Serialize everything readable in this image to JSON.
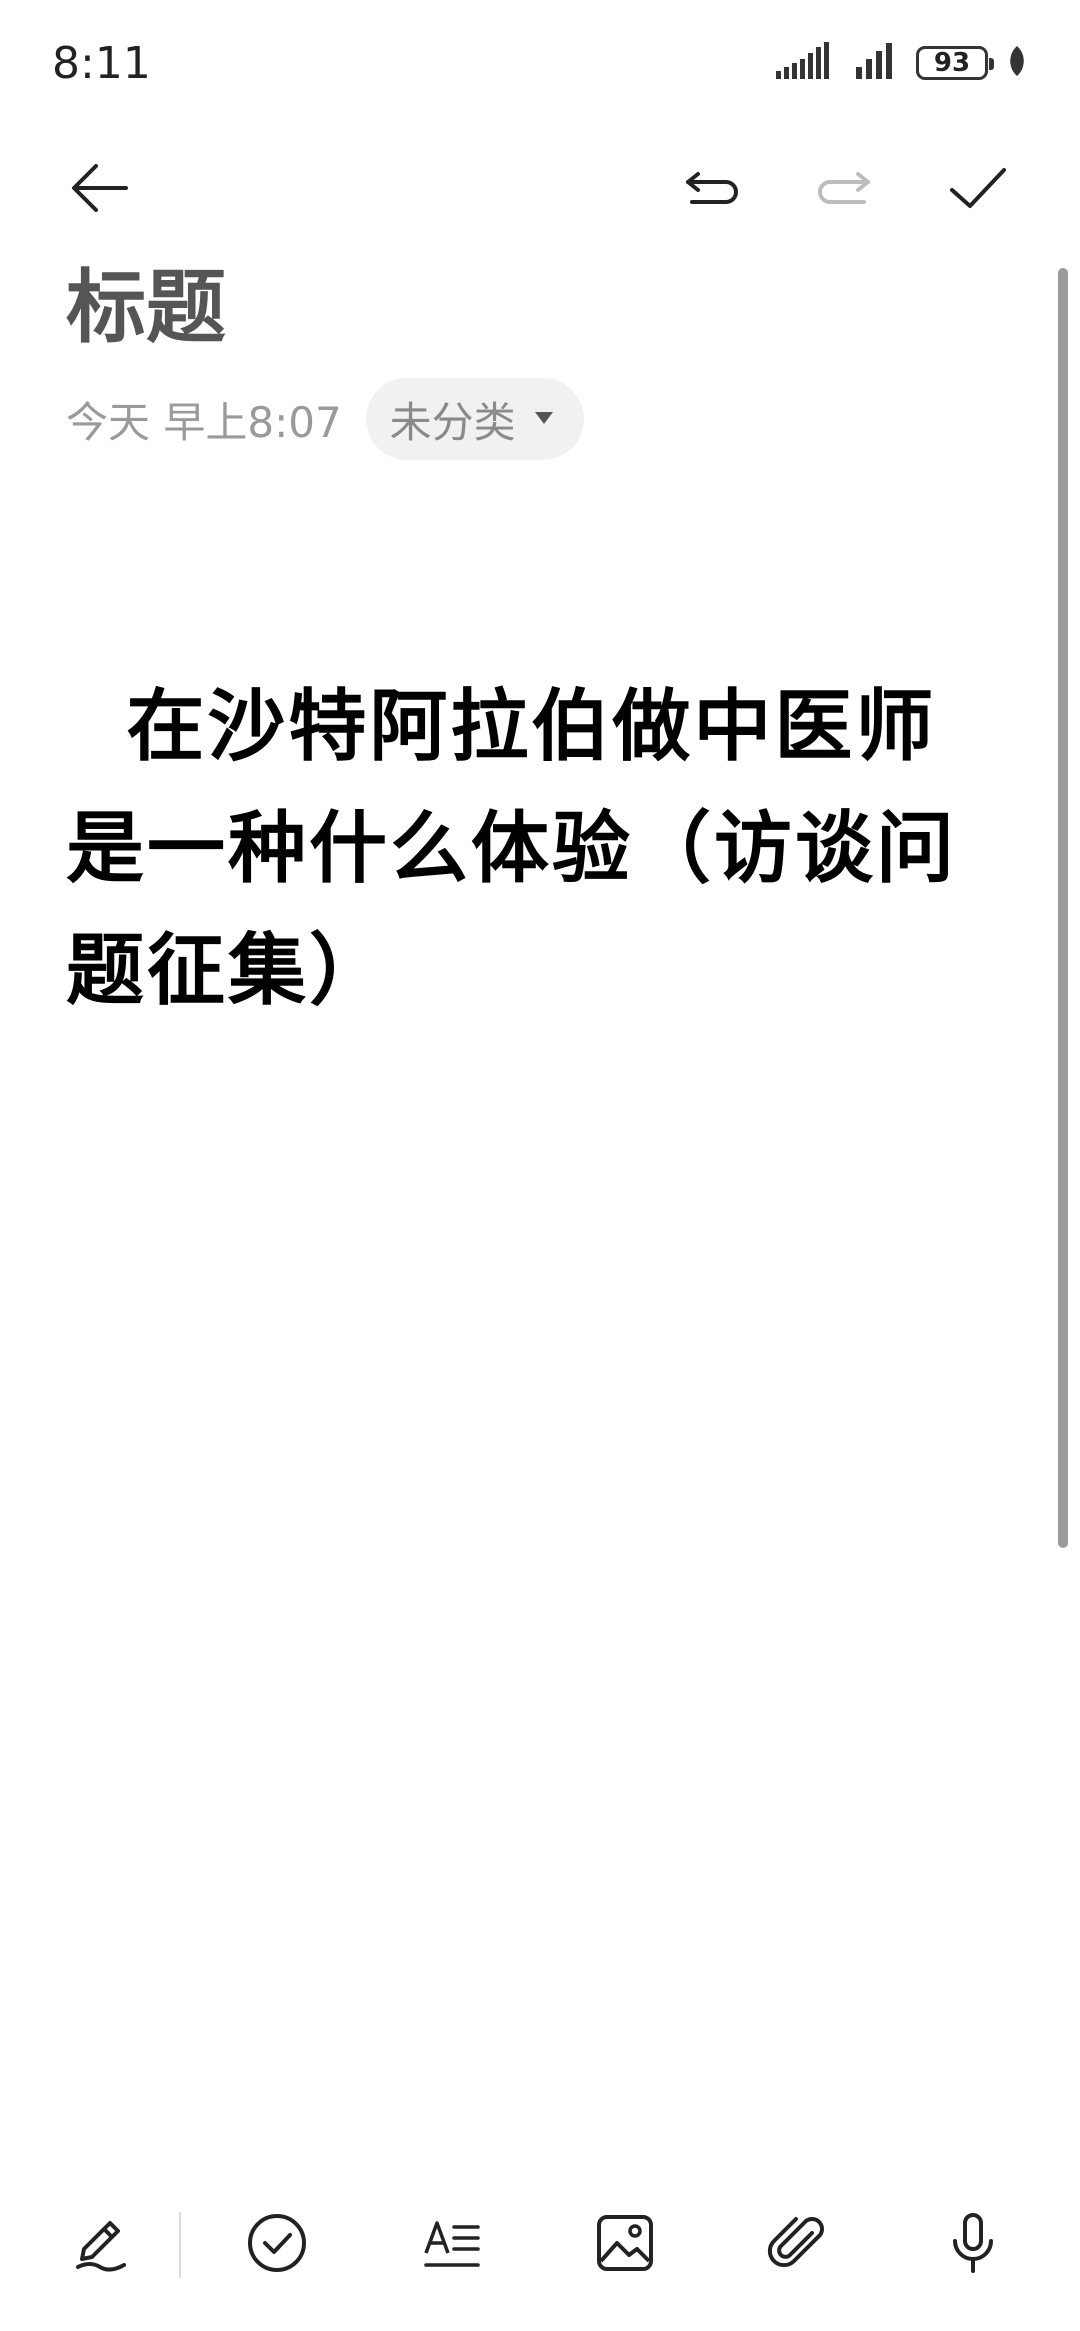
{
  "status": {
    "time": "8:11",
    "battery": "93",
    "icons": [
      "signal-icon",
      "signal-icon",
      "battery-icon",
      "leaf-icon"
    ]
  },
  "toolbar": {
    "back": "back-arrow-icon",
    "undo": "undo-icon",
    "redo": "redo-icon",
    "done": "checkmark-icon"
  },
  "note": {
    "title": "标题",
    "date": "今天 早上8:07",
    "category": "未分类",
    "body": "  在沙特阿拉伯做中医师是一种什么体验（访谈问题征集）"
  },
  "bottom_toolbar": [
    "pen-icon",
    "checklist-icon",
    "text-format-icon",
    "image-icon",
    "attachment-icon",
    "microphone-icon"
  ],
  "colors": {
    "title": "#555555",
    "meta": "#9a9a9a",
    "chip_bg": "#f1f1f1",
    "text": "#000000"
  }
}
